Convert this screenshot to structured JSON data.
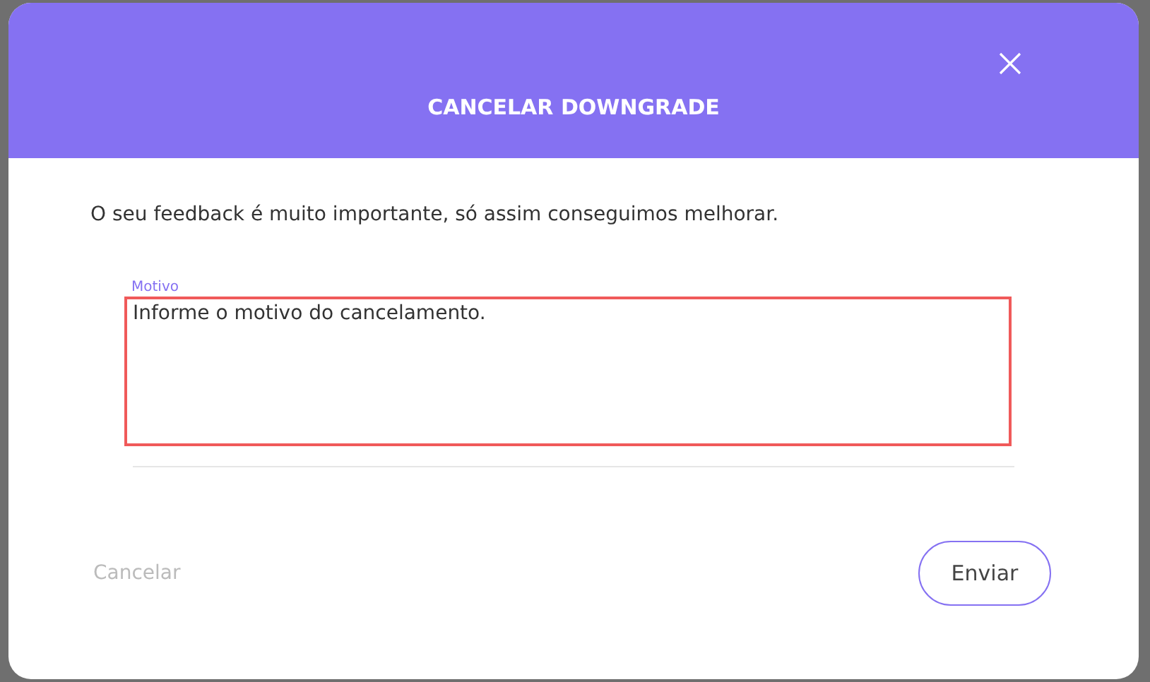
{
  "dialog": {
    "title": "CANCELAR DOWNGRADE",
    "message": "O seu feedback é muito importante, só assim conseguimos melhorar.",
    "field": {
      "label": "Motivo",
      "value": "Informe o motivo do cancelamento.",
      "error": true
    },
    "buttons": [
      {
        "kind": "text",
        "label": "Cancelar",
        "disabled": true
      },
      {
        "kind": "outline",
        "label": "Enviar",
        "disabled": false
      }
    ]
  }
}
